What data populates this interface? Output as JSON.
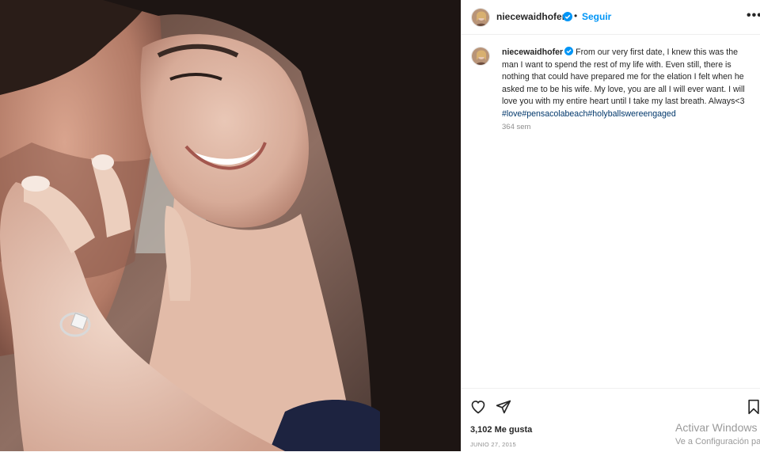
{
  "post": {
    "photo_description_icon": "photo",
    "author": {
      "username": "niecewaidhofer",
      "verified_icon": "verified-badge-icon"
    },
    "header": {
      "separator": "•",
      "follow_label": "Seguir",
      "more_icon": "more-options-icon",
      "more_glyph": "•••"
    },
    "caption": {
      "username": "niecewaidhofer",
      "text": "From our very first date, I knew this was the man I want to spend the rest of my life with. Even still, there is nothing that could have prepared me for the elation I felt when he asked me to be his wife. My love, you are all I will ever want. I will love you with my entire heart until I take my last breath. Always<3 ",
      "hashtags": [
        "#love",
        "#pensacolabeach",
        "#holyballswereengaged"
      ],
      "time_ago": "364 sem"
    },
    "actions": {
      "like_icon": "heart-icon",
      "share_icon": "send-icon",
      "save_icon": "bookmark-icon",
      "likes_text": "3,102 Me gusta",
      "date_text": "JUNIO 27, 2015"
    }
  },
  "os_overlay": {
    "line1": "Activar Windows",
    "line2": "Ve a Configuración para activar Windows."
  },
  "colors": {
    "link_blue": "#0095f6",
    "hashtag": "#00376b",
    "text": "#262626",
    "muted": "#8e8e8e"
  }
}
